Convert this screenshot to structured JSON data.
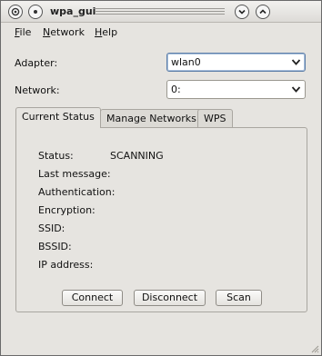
{
  "window": {
    "title": "wpa_gui"
  },
  "menubar": {
    "items": [
      {
        "label": "File"
      },
      {
        "label": "Network"
      },
      {
        "label": "Help"
      }
    ]
  },
  "form": {
    "adapter_label": "Adapter:",
    "adapter_value": "wlan0",
    "network_label": "Network:",
    "network_value": "0:"
  },
  "tabs": [
    {
      "label": "Current Status",
      "active": true
    },
    {
      "label": "Manage Networks",
      "active": false
    },
    {
      "label": "WPS",
      "active": false
    }
  ],
  "status": {
    "rows": [
      {
        "label": "Status:",
        "value": "SCANNING"
      },
      {
        "label": "Last message:",
        "value": ""
      },
      {
        "label": "Authentication:",
        "value": ""
      },
      {
        "label": "Encryption:",
        "value": ""
      },
      {
        "label": "SSID:",
        "value": ""
      },
      {
        "label": "BSSID:",
        "value": ""
      },
      {
        "label": "IP address:",
        "value": ""
      }
    ]
  },
  "buttons": {
    "connect": "Connect",
    "disconnect": "Disconnect",
    "scan": "Scan"
  },
  "icons": {
    "app": "wifi-app-icon",
    "menu": "window-menu-icon",
    "minimize": "chevron-down-icon",
    "maximize": "chevron-up-icon"
  }
}
